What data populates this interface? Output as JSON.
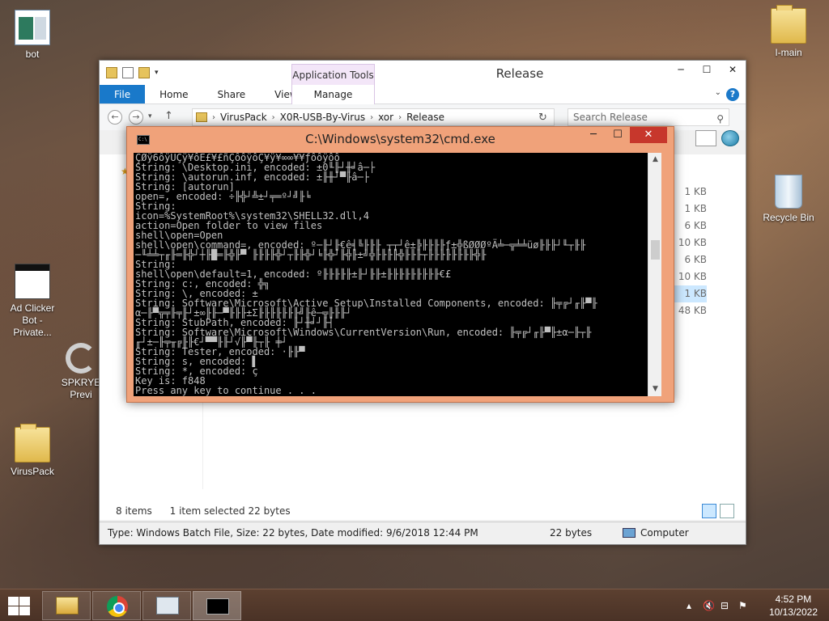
{
  "desktop": {
    "icons": [
      {
        "label": "bot"
      },
      {
        "label": "Ad Clicker Bot - Private..."
      },
      {
        "label": "SPKRYE Previ"
      },
      {
        "label": "VirusPack"
      },
      {
        "label": "I-main"
      },
      {
        "label": "Recycle Bin"
      }
    ]
  },
  "explorer": {
    "title": "Release",
    "app_tools_tab": "Application Tools",
    "tabs": [
      "File",
      "Home",
      "Share",
      "View",
      "Manage"
    ],
    "breadcrumbs": [
      "VirusPack",
      "X0R-USB-By-Virus",
      "xor",
      "Release"
    ],
    "search_placeholder": "Search Release",
    "sizes": [
      "1 KB",
      "1 KB",
      "6 KB",
      "10 KB",
      "6 KB",
      "10 KB",
      "1 KB",
      "48 KB"
    ],
    "status_items": "8 items",
    "status_selected": "1 item selected  22 bytes",
    "details": "Type: Windows Batch File, Size: 22 bytes, Date modified: 9/6/2018 12:44 PM",
    "details_size": "22 bytes",
    "details_location": "Computer",
    "controls": {
      "minimize": "─",
      "maximize": "☐",
      "close": "✕",
      "help": "?",
      "ribbon_expand": "⌄"
    }
  },
  "cmd": {
    "title": "C:\\Windows\\system32\\cmd.exe",
    "controls": {
      "minimize": "─",
      "maximize": "☐",
      "close": "✕"
    },
    "lines": [
      "ÇØÿ6ôÿÜÇÿ¥ôÉ£¥£ñÇôôÿôÇ¥ÿ¥∞∞¥¥ƒôôÿôô",
      "String: \\Desktop.ini, encoded: ±0╙╟┘╫╛â─├",
      "String: \\autorun.inf, encoded: ±╟╫┘▀╟â─├",
      "String: [autorun]",
      "open=, encoded: ÷╟╬┘╩±┘╤═º┘╝╟╘",
      "String:",
      "icon=%SystemRoot%\\system32\\SHELL32.dll,4",
      "action=Open folder to view files",
      "shell\\open=Open",
      "shell\\open\\command=, encoded: º─╟┘╟€ê╡╚╟╟╟ ┬┬┘ê±╠╟╟╟╟ƒ±╬ßØØØºÄ╧─╦╧╧üø╟╟╟┘╙┬╟╟",
      "─╙╧╧┬╓╟═╟╬┘┼╟█═╟╬╟▀ ╟╟╟╟╬┘┬╟╟╬┘╘╟╬┘╟╬╟±╝╬╟╟╟╟╬╟╟╟┬╟╟╟╟╟╟╟╟╬╟",
      "String:",
      "shell\\open\\default=1, encoded: º╟╟╟╟╟±╟┘╟╟±╟╟╟╟╟╟╟╟╟€£",
      "String: c:, encoded: ╬╗",
      "String: \\, encoded: ±",
      "String: Software\\Microsoft\\Active Setup\\Installed Components, encoded: ╟╤╔┘╓╟▀╟",
      "α─╟▀╦╤╟╤╟┘±∞╟╟─▀╟╟╟±Σ╟╟╟╟╟╟╟╝╟ê─╦╟╟╟┘",
      "String: StubPath, encoded: ╟┘╫╛┘╟┤",
      "String: Software\\Microsoft\\Windows\\CurrentVersion\\Run, encoded: ╟╤╔┘╓╟▀╟±α─╟┬╟",
      "╓┘±─╟╤╥╔╟╟€┘▀▀╟╟┘√╟▀╟┬╟ ╪┘",
      "String: Tester, encoded: ·╟╟▀",
      "String: s, encoded: ▌",
      "String: *, encoded: ç",
      "Key is: f848",
      "Press any key to continue . . ."
    ]
  },
  "taskbar": {
    "time": "4:52 PM",
    "date": "10/13/2022"
  },
  "colors": {
    "accent": "#1979ca",
    "cmd_frame": "#f0a27a",
    "close_red": "#c7372c"
  }
}
